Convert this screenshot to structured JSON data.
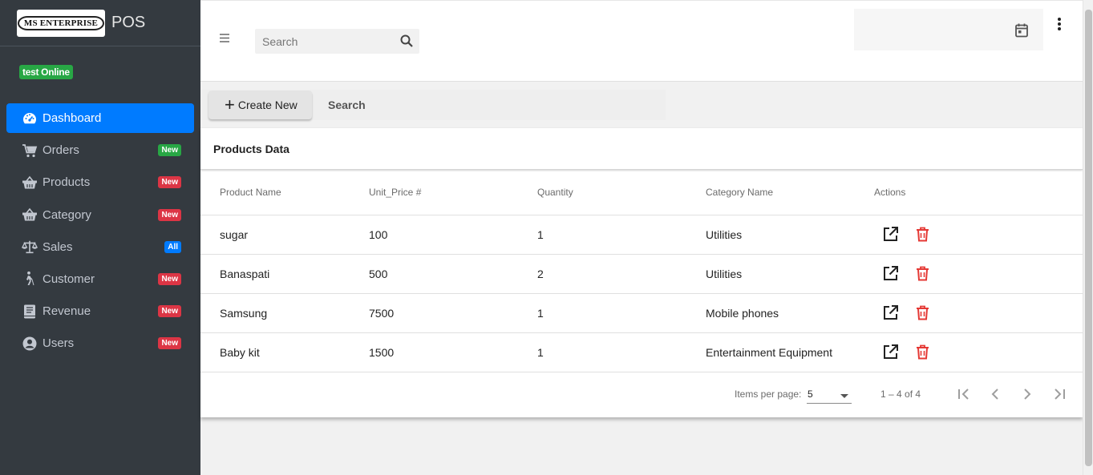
{
  "brand": {
    "logo_text": "MS ENTERPRISE",
    "app_name": "POS"
  },
  "user": {
    "status": "test Online"
  },
  "sidebar": {
    "items": [
      {
        "label": "Dashboard",
        "icon": "dashboard-icon",
        "badge": ""
      },
      {
        "label": "Orders",
        "icon": "cart-icon",
        "badge": "New",
        "badge_color": "#28a745"
      },
      {
        "label": "Products",
        "icon": "basket-icon",
        "badge": "New",
        "badge_color": "#dc3545"
      },
      {
        "label": "Category",
        "icon": "basket-icon",
        "badge": "New",
        "badge_color": "#dc3545"
      },
      {
        "label": "Sales",
        "icon": "scale-icon",
        "badge": "All",
        "badge_color": "#007bff"
      },
      {
        "label": "Customer",
        "icon": "walking-person-icon",
        "badge": "New",
        "badge_color": "#dc3545"
      },
      {
        "label": "Revenue",
        "icon": "book-icon",
        "badge": "New",
        "badge_color": "#dc3545"
      },
      {
        "label": "Users",
        "icon": "user-circle-icon",
        "badge": "New",
        "badge_color": "#dc3545"
      }
    ]
  },
  "header": {
    "search_placeholder": "Search"
  },
  "toolbar": {
    "create_label": "Create New",
    "search_label": "Search"
  },
  "products": {
    "title": "Products Data",
    "columns": [
      "Product Name",
      "Unit_Price #",
      "Quantity",
      "Category Name",
      "Actions"
    ],
    "rows": [
      {
        "name": "sugar",
        "price": "100",
        "qty": "1",
        "category": "Utilities"
      },
      {
        "name": "Banaspati",
        "price": "500",
        "qty": "2",
        "category": "Utilities"
      },
      {
        "name": "Samsung",
        "price": "7500",
        "qty": "1",
        "category": "Mobile phones"
      },
      {
        "name": "Baby kit",
        "price": "1500",
        "qty": "1",
        "category": "Entertainment Equipment"
      }
    ]
  },
  "paginator": {
    "items_per_page_label": "Items per page:",
    "items_per_page": "5",
    "range": "1 – 4 of 4"
  },
  "colors": {
    "accent": "#007bff",
    "sidebar": "#343a40",
    "delete": "#e53935"
  }
}
